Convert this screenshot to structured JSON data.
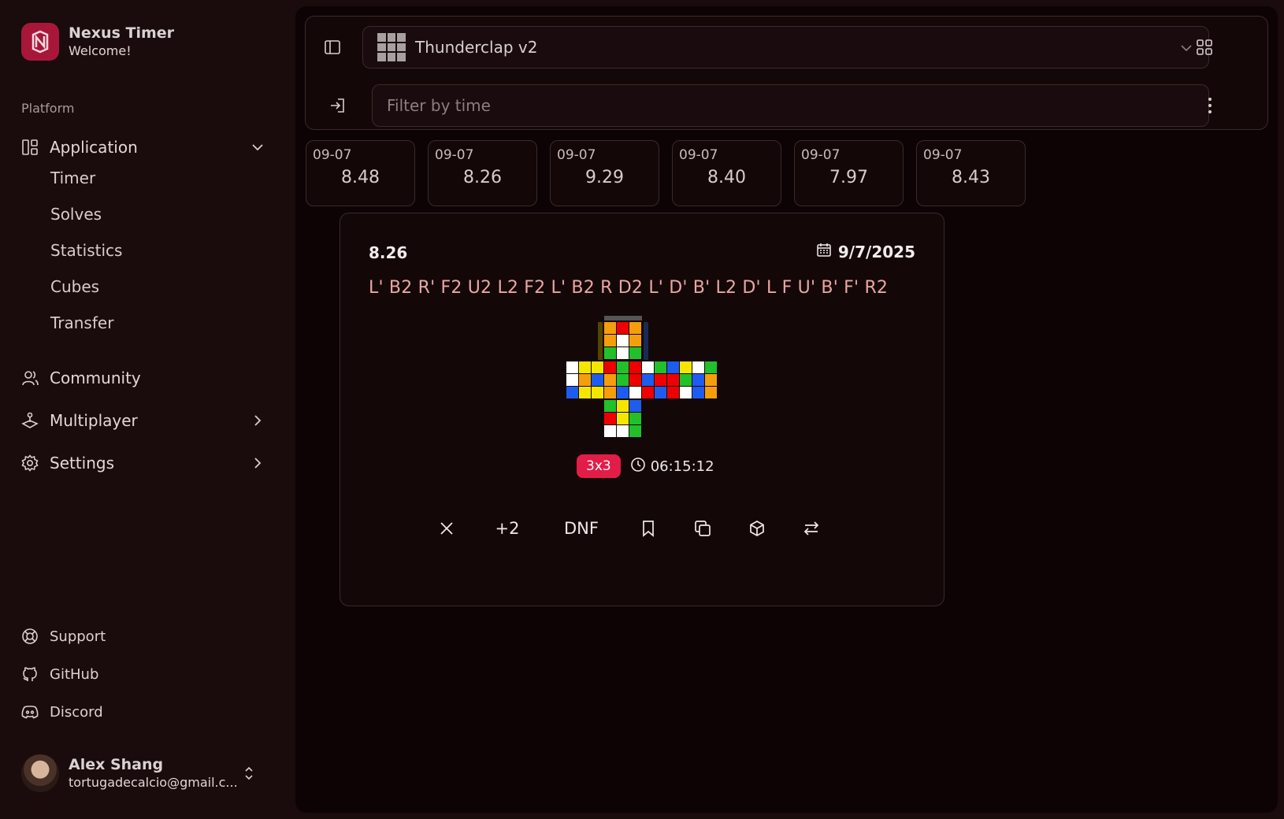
{
  "brand": {
    "title": "Nexus Timer",
    "subtitle": "Welcome!"
  },
  "sidebar": {
    "section_label": "Platform",
    "application": {
      "label": "Application",
      "icon": "layout-dashboard-icon"
    },
    "sub_items": [
      {
        "label": "Timer"
      },
      {
        "label": "Solves"
      },
      {
        "label": "Statistics"
      },
      {
        "label": "Cubes"
      },
      {
        "label": "Transfer"
      }
    ],
    "community": {
      "label": "Community",
      "icon": "users-icon"
    },
    "multiplayer": {
      "label": "Multiplayer",
      "icon": "joystick-icon"
    },
    "settings": {
      "label": "Settings",
      "icon": "gear-icon"
    },
    "footer": [
      {
        "label": "Support",
        "icon": "lifebuoy-icon"
      },
      {
        "label": "GitHub",
        "icon": "github-icon"
      },
      {
        "label": "Discord",
        "icon": "discord-icon"
      }
    ]
  },
  "user": {
    "name": "Alex Shang",
    "email": "tortugadecalcio@gmail.c..."
  },
  "toolbar": {
    "cube_select": "Thunderclap v2",
    "filter_placeholder": "Filter by time"
  },
  "solves": [
    {
      "date": "09-07",
      "time": "8.48"
    },
    {
      "date": "09-07",
      "time": "8.26"
    },
    {
      "date": "09-07",
      "time": "9.29"
    },
    {
      "date": "09-07",
      "time": "8.40"
    },
    {
      "date": "09-07",
      "time": "7.97"
    },
    {
      "date": "09-07",
      "time": "8.43"
    }
  ],
  "detail": {
    "time": "8.26",
    "date": "9/7/2025",
    "scramble": "L' B2 R' F2 U2 L2 F2 L' B2 R D2 L' D' B' L2 D' L F U' B' F' R2",
    "category": "3x3",
    "duration": "06:15:12",
    "actions": {
      "plus2": "+2",
      "dnf": "DNF"
    }
  },
  "colors": {
    "accent": "#e11d48",
    "brand": "#a8173a",
    "scramble": "#e9a7a5"
  }
}
